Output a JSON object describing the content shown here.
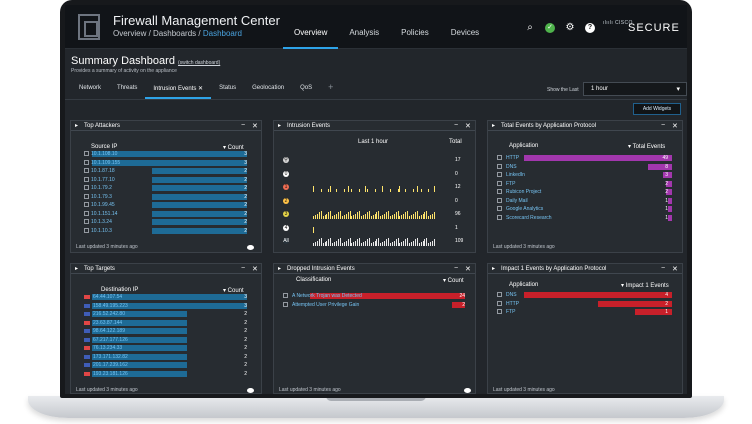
{
  "app": {
    "title": "Firewall Management Center",
    "crumbs": [
      "Overview",
      "/ Dashboards /",
      "Dashboard"
    ],
    "brand_small": "ılıılı\nCISCO",
    "brand": "SECURE"
  },
  "nav": [
    "Overview",
    "Analysis",
    "Policies",
    "Devices"
  ],
  "dashboard": {
    "title": "Summary Dashboard",
    "switch": "(switch dashboard)",
    "subtitle": "Provides a summary of activity on the appliance"
  },
  "tabs": [
    "Network",
    "Threats",
    "Intrusion Events ✕",
    "Status",
    "Geolocation",
    "QoS",
    "+"
  ],
  "show_last": {
    "label": "Show the Last",
    "value": "1 hour"
  },
  "add_widgets": "Add Widgets",
  "widgets": {
    "attackers": {
      "title": "Top Attackers",
      "col": "Source IP",
      "count": "▾ Count",
      "footer": "Last updated 3 minutes ago",
      "rows": [
        "10.1.108.10",
        "10.1.109.155",
        "10.1.87.18",
        "10.1.77.10",
        "10.1.79.2",
        "10.1.79.3",
        "10.1.99.45",
        "10.1.151.14",
        "10.1.3.24",
        "10.1.10.3"
      ],
      "values": [
        3,
        3,
        2,
        2,
        2,
        2,
        2,
        2,
        2,
        2
      ]
    },
    "targets": {
      "title": "Top Targets",
      "col": "Destination IP",
      "count": "▾ Count",
      "footer": "Last updated 3 minutes ago",
      "rows": [
        "64.44.107.54",
        "158.49.195.223",
        "216.52.242.80",
        "23.63.87.144",
        "98.64.122.189",
        "67.217.177.126",
        "76.13.234.33",
        "173.171.132.82",
        "201.17.239.162",
        "193.23.181.126"
      ],
      "values": [
        3,
        3,
        2,
        2,
        2,
        2,
        2,
        2,
        2,
        2
      ]
    },
    "intrusion": {
      "title": "Intrusion Events",
      "header": "Last 1 hour",
      "total": "Total",
      "rows": [
        {
          "icon": "⚲",
          "color": "#d7d7d7",
          "total": "17"
        },
        {
          "icon": "0",
          "color": "#ffffff",
          "total": "0"
        },
        {
          "icon": "1",
          "color": "#f06d53",
          "total": "12"
        },
        {
          "icon": "2",
          "color": "#ffc247",
          "total": "0"
        },
        {
          "icon": "3",
          "color": "#e5d449",
          "total": "96"
        },
        {
          "icon": "4",
          "color": "#ffffff",
          "total": "1"
        },
        {
          "icon": "All",
          "color": "#27323a",
          "total": "109"
        }
      ]
    },
    "dropped": {
      "title": "Dropped Intrusion Events",
      "col": "Classification",
      "count": "▾ Count",
      "footer": "Last updated 3 minutes ago",
      "rows": [
        {
          "label": "A Network Trojan was Detected",
          "value": "24"
        },
        {
          "label": "Attempted User Privilege Gain",
          "value": "2"
        }
      ]
    },
    "protocol": {
      "title": "Total Events by Application Protocol",
      "col": "Application",
      "count": "▾ Total Events",
      "footer": "Last updated 3 minutes ago",
      "rows": [
        {
          "label": "HTTP",
          "value": "49"
        },
        {
          "label": "DNS",
          "value": "8"
        },
        {
          "label": "LinkedIn",
          "value": "3"
        },
        {
          "label": "FTP",
          "value": "2"
        },
        {
          "label": "Rubicon Project",
          "value": "2"
        },
        {
          "label": "Daily Mail",
          "value": "1"
        },
        {
          "label": "Google Analytics",
          "value": "1"
        },
        {
          "label": "Scorecard Research",
          "value": "1"
        }
      ]
    },
    "impact": {
      "title": "Impact 1 Events by Application Protocol",
      "col": "Application",
      "count": "▾ Impact 1 Events",
      "footer": "Last updated 3 minutes ago",
      "rows": [
        {
          "label": "DNS",
          "value": "4"
        },
        {
          "label": "HTTP",
          "value": "2"
        },
        {
          "label": "FTP",
          "value": "1"
        }
      ]
    }
  }
}
